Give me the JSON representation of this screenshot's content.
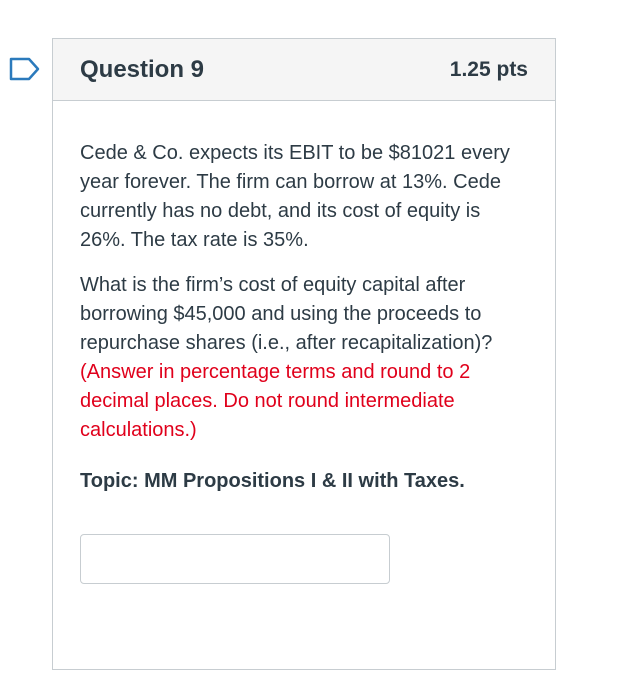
{
  "question": {
    "title": "Question 9",
    "points": "1.25 pts",
    "paragraph1": "Cede & Co. expects its EBIT to be $81021 every year forever. The firm can borrow at 13%. Cede currently has no debt, and its cost of equity is 26%. The tax rate is 35%.",
    "paragraph2_prompt": "What is the firm’s cost of equity capital after borrowing $45,000 and using the proceeds to repurchase shares (i.e., after recapitalization)?",
    "paragraph2_instruction": "(Answer in percentage terms and round to 2 decimal places. Do not round intermediate calculations.)",
    "topic": "Topic: MM Propositions I & II with Taxes."
  },
  "answer": {
    "value": ""
  },
  "colors": {
    "flag": "#2b7abc",
    "instruction": "#e0001b",
    "header_bg": "#f5f5f5",
    "border": "#c7cdd1"
  }
}
